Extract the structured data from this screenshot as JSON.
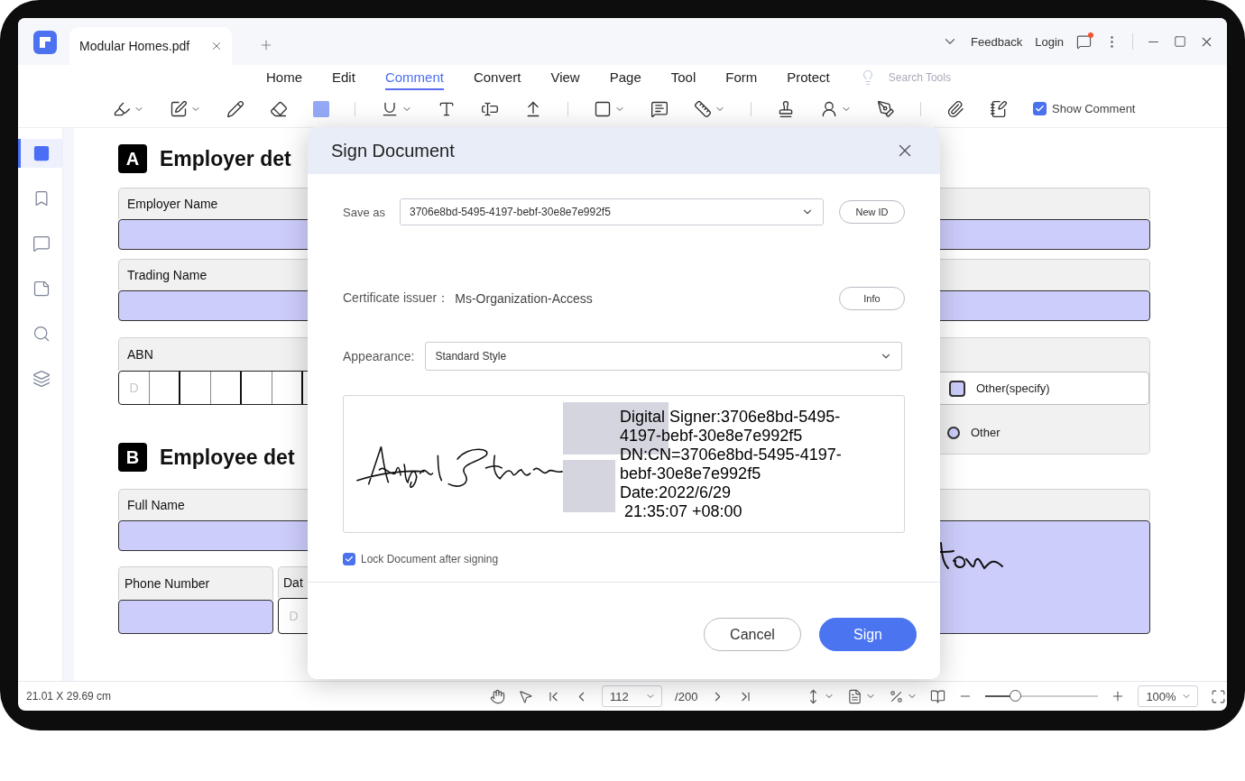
{
  "title_bar": {
    "tab": "Modular Homes.pdf",
    "links": [
      "Feedback",
      "Login"
    ]
  },
  "menu": [
    {
      "label": "Home",
      "selected": false
    },
    {
      "label": "Edit",
      "selected": false
    },
    {
      "label": "Comment",
      "selected": true
    },
    {
      "label": "Convert",
      "selected": false
    },
    {
      "label": "View",
      "selected": false
    },
    {
      "label": "Page",
      "selected": false
    },
    {
      "label": "Tool",
      "selected": false
    },
    {
      "label": "Form",
      "selected": false
    },
    {
      "label": "Protect",
      "selected": false
    }
  ],
  "search_tools": {
    "placeholder": "Search Tools"
  },
  "toolbar": {
    "show_comment": {
      "label": "Show Comment",
      "checked": true
    }
  },
  "sidebar": {
    "items": [
      {
        "kind": "thumbnails",
        "selected": true
      },
      {
        "kind": "bookmark",
        "selected": false
      },
      {
        "kind": "comment",
        "selected": false
      },
      {
        "kind": "attachment",
        "selected": false
      },
      {
        "kind": "search",
        "selected": false
      },
      {
        "kind": "layers",
        "selected": false
      }
    ]
  },
  "document": {
    "section_a": {
      "letter": "A",
      "title": "Employer det",
      "fields": [
        {
          "label": "Employer Name"
        },
        {
          "label": "Trading Name"
        }
      ],
      "abn": {
        "label": "ABN",
        "placeholder": "D"
      },
      "options": [
        {
          "kind": "checkbox",
          "label": "Other(specify)",
          "checked": false
        },
        {
          "kind": "radio",
          "label": "Other",
          "selected": false
        }
      ]
    },
    "section_b": {
      "letter": "B",
      "title": "Employee det",
      "full_name": {
        "label": "Full Name"
      },
      "phone": {
        "label": "Phone Number"
      },
      "date": {
        "label": "Dat",
        "placeholder": "D"
      }
    }
  },
  "dialog": {
    "title": "Sign Document",
    "save_as": {
      "label": "Save as",
      "value": "3706e8bd-5495-4197-bebf-30e8e7e992f5",
      "button": "New ID"
    },
    "certificate": {
      "label": "Certificate issuer：",
      "value": "Ms-Organization-Access",
      "button": "Info"
    },
    "appearance": {
      "label": "Appearance:",
      "value": "Standard Style"
    },
    "preview": {
      "text": "Digital Signer:3706e8bd-5495-\n4197-bebf-30e8e7e992f5\nDN:CN=3706e8bd-5495-4197-\nbebf-30e8e7e992f5\nDate:2022/6/29\n 21:35:07 +08:00"
    },
    "lock": {
      "label": "Lock Document after signing",
      "checked": true
    },
    "buttons": [
      {
        "label": "Cancel",
        "kind": "secondary"
      },
      {
        "label": "Sign",
        "kind": "primary"
      }
    ]
  },
  "status_bar": {
    "dimensions": "21.01 X 29.69 cm",
    "page": "112",
    "total": "/200",
    "zoom_slider": {
      "level": 0.26
    },
    "zoom": "100%"
  }
}
